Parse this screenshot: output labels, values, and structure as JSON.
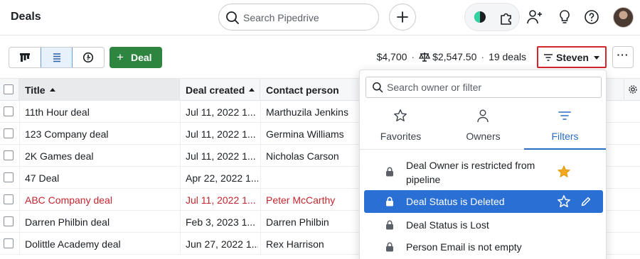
{
  "header": {
    "title": "Deals",
    "search_placeholder": "Search Pipedrive"
  },
  "toolbar": {
    "add_deal_label": "Deal",
    "total_value": "$4,700",
    "weighted_value": "$2,547.50",
    "deal_count": "19 deals",
    "owner_filter_label": "Steven",
    "more_label": "···"
  },
  "table": {
    "columns": [
      "Title",
      "Deal created",
      "Contact person"
    ],
    "rows": [
      {
        "title": "11th Hour deal",
        "created": "Jul 11, 2022 1...",
        "contact": "Marthuzila Jenkins"
      },
      {
        "title": "123 Company deal",
        "created": "Jul 11, 2022 1...",
        "contact": "Germina Williams"
      },
      {
        "title": "2K Games deal",
        "created": "Jul 11, 2022 1...",
        "contact": "Nicholas Carson"
      },
      {
        "title": "47 Deal",
        "created": "Apr 22, 2022 1...",
        "contact": ""
      },
      {
        "title": "ABC Company deal",
        "created": "Jul 11, 2022 1...",
        "contact": "Peter McCarthy",
        "highlight": "red"
      },
      {
        "title": "Darren Philbin deal",
        "created": "Feb 3, 2023 1...",
        "contact": "Darren Philbin"
      },
      {
        "title": "Dolittle Academy deal",
        "created": "Jun 27, 2022 1...",
        "contact": "Rex Harrison"
      }
    ]
  },
  "filter_panel": {
    "search_placeholder": "Search owner or filter",
    "tabs": [
      {
        "label": "Favorites",
        "icon": "star-icon"
      },
      {
        "label": "Owners",
        "icon": "person-icon"
      },
      {
        "label": "Filters",
        "icon": "filter-icon",
        "active": true
      }
    ],
    "filters": [
      {
        "line1": "Deal Owner is restricted from",
        "line2": "pipeline",
        "favorite": true
      },
      {
        "line1": "Deal Status is Deleted",
        "selected": true
      },
      {
        "line1": "Deal Status is Lost"
      },
      {
        "line1": "Person Email is not empty"
      }
    ]
  },
  "colors": {
    "accent_blue": "#2a6fd4",
    "deal_green": "#2e8540",
    "highlight_red": "#c4262e",
    "star_gold": "#f2a81d"
  }
}
